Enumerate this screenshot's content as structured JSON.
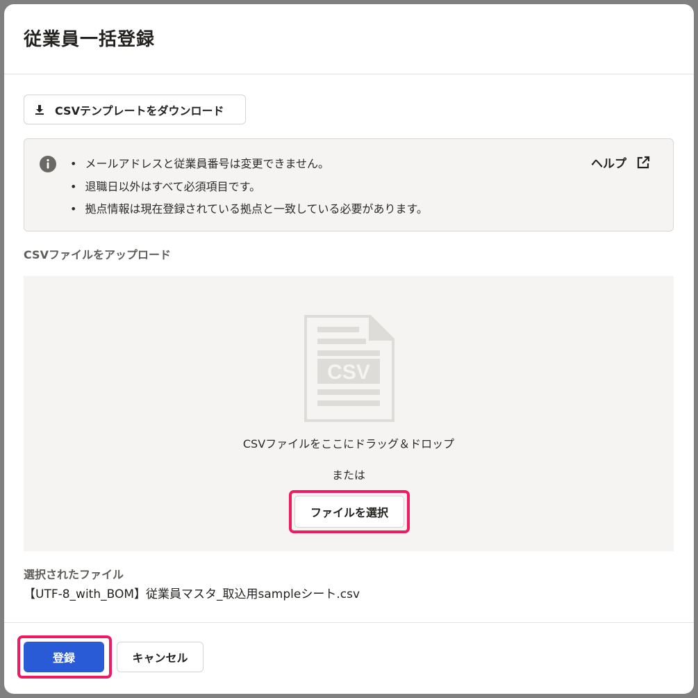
{
  "modal": {
    "title": "従業員一括登録"
  },
  "toolbar": {
    "download_label": "CSVテンプレートをダウンロード"
  },
  "info": {
    "items": [
      "メールアドレスと従業員番号は変更できません。",
      "退職日以外はすべて必須項目です。",
      "拠点情報は現在登録されている拠点と一致している必要があります。"
    ],
    "help_label": "ヘルプ"
  },
  "upload": {
    "section_label": "CSVファイルをアップロード",
    "icon_text": "CSV",
    "drop_text": "CSVファイルをここにドラッグ＆ドロップ",
    "or_text": "または",
    "select_label": "ファイルを選択"
  },
  "selected": {
    "label": "選択されたファイル",
    "filename": "【UTF-8_with_BOM】従業員マスタ_取込用sampleシート.csv"
  },
  "footer": {
    "register_label": "登録",
    "cancel_label": "キャンセル"
  },
  "colors": {
    "primary": "#2a5bd7",
    "highlight": "#ee1b63",
    "panel": "#f5f4f3"
  }
}
